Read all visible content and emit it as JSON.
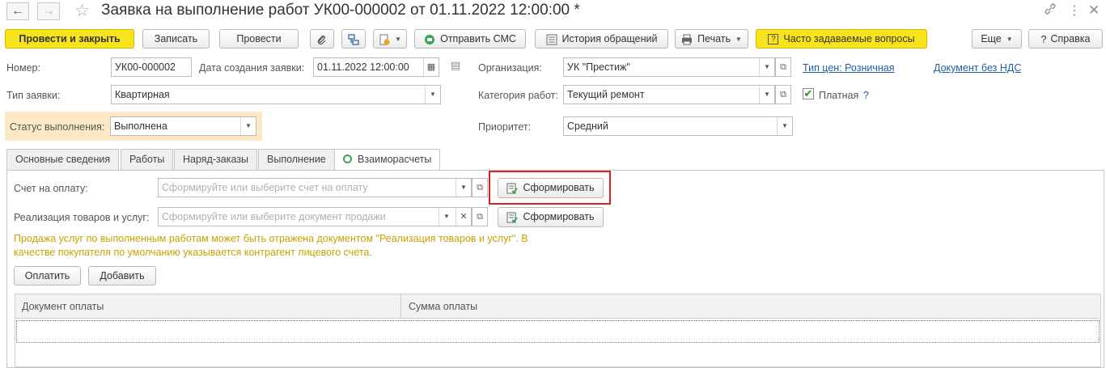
{
  "window": {
    "title": "Заявка на выполнение работ УК00-000002 от 01.11.2022 12:00:00 *",
    "nav_back": "←",
    "nav_forward": "→"
  },
  "toolbar": {
    "post_close": "Провести и закрыть",
    "save": "Записать",
    "post": "Провести",
    "send_sms": "Отправить СМС",
    "history": "История обращений",
    "print": "Печать",
    "faq": "Часто задаваемые вопросы",
    "more": "Еще",
    "help": "Справка",
    "help_mark": "?"
  },
  "form": {
    "number_label": "Номер:",
    "number_value": "УК00-000002",
    "created_label": "Дата создания заявки:",
    "created_value": "01.11.2022 12:00:00",
    "org_label": "Организация:",
    "org_value": "УК \"Престиж\"",
    "price_type_link": "Тип цен: Розничная",
    "vat_link": "Документ без НДС",
    "request_type_label": "Тип заявки:",
    "request_type_value": "Квартирная",
    "work_category_label": "Категория работ:",
    "work_category_value": "Текущий ремонт",
    "paid_label": "Платная",
    "paid_checked": true,
    "paid_help": "?",
    "status_label": "Статус выполнения:",
    "status_value": "Выполнена",
    "priority_label": "Приоритет:",
    "priority_value": "Средний"
  },
  "tabs": [
    {
      "label": "Основные сведения"
    },
    {
      "label": "Работы"
    },
    {
      "label": "Наряд-заказы"
    },
    {
      "label": "Выполнение"
    },
    {
      "label": "Взаиморасчеты",
      "active": true
    }
  ],
  "settlements": {
    "invoice_label": "Счет на оплату:",
    "invoice_placeholder": "Сформируйте или выберите счет на оплату",
    "sales_label": "Реализация товаров и услуг:",
    "sales_placeholder": "Сформируйте или выберите документ продажи",
    "generate_label": "Сформировать",
    "info_line1": "Продажа услуг по выполненным работам может быть отражена документом \"Реализация товаров и услуг\". В",
    "info_line2": "качестве покупателя по умолчанию указывается контрагент лицевого счета.",
    "pay_button": "Оплатить",
    "add_button": "Добавить",
    "columns": [
      "Документ оплаты",
      "Сумма оплаты"
    ],
    "rows": []
  },
  "colors": {
    "accent_yellow": "#f8e41c",
    "link_blue": "#1f5fa8",
    "highlight_red": "#e02020",
    "status_highlight": "#fbe9c6",
    "info_text": "#c9a100"
  }
}
